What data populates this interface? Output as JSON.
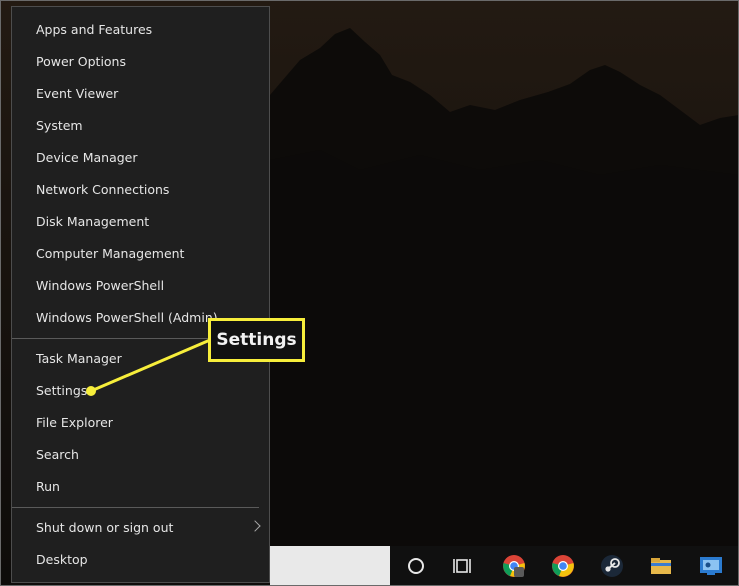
{
  "menu": {
    "items": [
      {
        "label": "Apps and Features"
      },
      {
        "label": "Power Options"
      },
      {
        "label": "Event Viewer"
      },
      {
        "label": "System"
      },
      {
        "label": "Device Manager"
      },
      {
        "label": "Network Connections"
      },
      {
        "label": "Disk Management"
      },
      {
        "label": "Computer Management"
      },
      {
        "label": "Windows PowerShell"
      },
      {
        "label": "Windows PowerShell (Admin)"
      },
      {
        "label": "Task Manager"
      },
      {
        "label": "Settings"
      },
      {
        "label": "File Explorer"
      },
      {
        "label": "Search"
      },
      {
        "label": "Run"
      },
      {
        "label": "Shut down or sign out",
        "submenu_icon": "chevron-right-icon"
      },
      {
        "label": "Desktop"
      }
    ]
  },
  "callout": {
    "label": "Settings",
    "color": "#f7ee3b",
    "target": "Settings"
  },
  "taskbar": {
    "icons": [
      {
        "name": "cortana-circle-icon"
      },
      {
        "name": "task-view-icon"
      },
      {
        "name": "chrome-icon"
      },
      {
        "name": "chrome-icon"
      },
      {
        "name": "steam-icon"
      },
      {
        "name": "file-explorer-icon"
      },
      {
        "name": "remote-desktop-icon"
      }
    ]
  },
  "colors": {
    "menu_bg": "#1f1f1f",
    "menu_text": "#e6e6e6",
    "highlight": "#f7ee3b",
    "desktop_bg": "#0f0d0b"
  }
}
